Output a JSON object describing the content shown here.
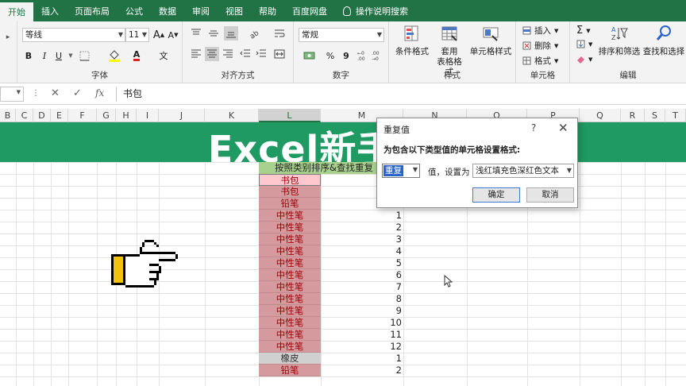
{
  "tabs": [
    "开始",
    "插入",
    "页面布局",
    "公式",
    "数据",
    "审阅",
    "视图",
    "帮助",
    "百度网盘",
    "操作说明搜索"
  ],
  "ribbon": {
    "font_name": "等线",
    "font_size": "11",
    "grow_font": "A",
    "shrink_font": "A",
    "bold": "B",
    "italic": "I",
    "underline": "U",
    "wen": "文",
    "font_group": "字体",
    "align_group": "对齐方式",
    "number_format": "常规",
    "percent": "%",
    "comma": "9",
    "number_group": "数字",
    "cond_format": "条件格式",
    "table_format_1": "套用",
    "table_format_2": "表格格式",
    "cell_style": "单元格样式",
    "style_group": "样式",
    "insert": "插入",
    "delete": "删除",
    "format": "格式",
    "cells_group": "单元格",
    "sort_filter": "排序和筛选",
    "find_select": "查找和选择",
    "edit_group": "编辑",
    "sigma": "Σ"
  },
  "formula_bar": {
    "fx": "fx",
    "content": "书包"
  },
  "columns": [
    "B",
    "C",
    "D",
    "E",
    "F",
    "G",
    "H",
    "I",
    "J",
    "K",
    "L",
    "M",
    "N",
    "O",
    "P",
    "Q",
    "R",
    "S",
    "T"
  ],
  "selected_column": "L",
  "banner": "Excel新手",
  "col_header_text": "按照类别排序&查找重复",
  "l_cells": [
    "书包",
    "书包",
    "铅笔",
    "中性笔",
    "中性笔",
    "中性笔",
    "中性笔",
    "中性笔",
    "中性笔",
    "中性笔",
    "中性笔",
    "中性笔",
    "中性笔",
    "中性笔",
    "中性笔",
    "橡皮",
    "铅笔"
  ],
  "m_cells": [
    "",
    "",
    "",
    "1",
    "2",
    "3",
    "4",
    "5",
    "6",
    "7",
    "8",
    "9",
    "10",
    "11",
    "12",
    "1",
    "2"
  ],
  "dialog": {
    "title": "重复值",
    "help": "?",
    "close": "✕",
    "instruction": "为包含以下类型值的单元格设置格式:",
    "type_value": "重复",
    "label": "值，设置为",
    "format_value": "浅红填充色深红色文本",
    "ok": "确定",
    "cancel": "取消"
  }
}
